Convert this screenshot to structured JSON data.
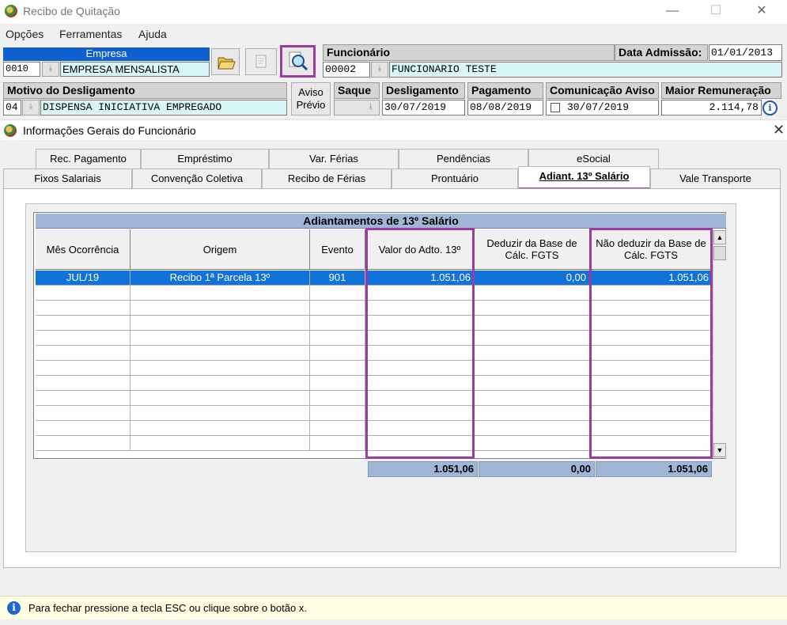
{
  "window": {
    "title": "Recibo de Quitação",
    "minimize_glyph": "—",
    "maximize_glyph": "☐",
    "close_glyph": "✕"
  },
  "menu": [
    "Opções",
    "Ferramentas",
    "Ajuda"
  ],
  "header": {
    "empresa_label": "Empresa",
    "empresa_code": "0010",
    "empresa_name": "EMPRESA MENSALISTA",
    "funcionario_label": "Funcionário",
    "funcionario_code": "00002",
    "funcionario_name": "FUNCIONARIO TESTE",
    "data_admissao_label": "Data Admissão:",
    "data_admissao_value": "01/01/2013",
    "motivo_label": "Motivo do Desligamento",
    "motivo_code": "04",
    "motivo_value": "DISPENSA INICIATIVA EMPREGADO",
    "aviso_previo_line1": "Aviso",
    "aviso_previo_line2": "Prévio",
    "saque_label": "Saque",
    "desligamento_label": "Desligamento",
    "desligamento_value": "30/07/2019",
    "pagamento_label": "Pagamento",
    "pagamento_value": "08/08/2019",
    "comunicacao_label": "Comunicação Aviso",
    "comunicacao_value": "30/07/2019",
    "maior_rem_label": "Maior Remuneração",
    "maior_rem_value": "2.114,78"
  },
  "section": {
    "title": "Informações Gerais do Funcionário",
    "close_glyph": "✕"
  },
  "tabs_row1": [
    "Rec. Pagamento",
    "Empréstimo",
    "Var. Férias",
    "Pendências",
    "eSocial"
  ],
  "tabs_row2": [
    "Fixos Salariais",
    "Convenção Coletiva",
    "Recibo de Férias",
    "Prontuário",
    "Adiant. 13º Salário",
    "Vale Transporte"
  ],
  "grid": {
    "title": "Adiantamentos de 13º Salário",
    "columns": [
      "Mês Ocorrência",
      "Origem",
      "Evento",
      "Valor do Adto. 13º",
      "Deduzir da Base de Cálc. FGTS",
      "Não deduzir da Base de Cálc. FGTS"
    ],
    "rows": [
      [
        "JUL/19",
        "Recibo 1ª Parcela 13º",
        "901",
        "1.051,06",
        "0,00",
        "1.051,06"
      ]
    ],
    "totals": [
      "1.051,06",
      "0,00",
      "1.051,06"
    ],
    "scroll_up": "▲",
    "scroll_down": "▼"
  },
  "status": {
    "info_glyph": "i",
    "message": "Para fechar pressione a tecla ESC ou clique sobre o botão x."
  },
  "colors": {
    "highlight": "#9b3d9f",
    "selected_row": "#1173d9",
    "grid_header": "#9fb6d6",
    "field_blue": "#0f5fcf",
    "field_cyan": "#d8f6f7"
  }
}
